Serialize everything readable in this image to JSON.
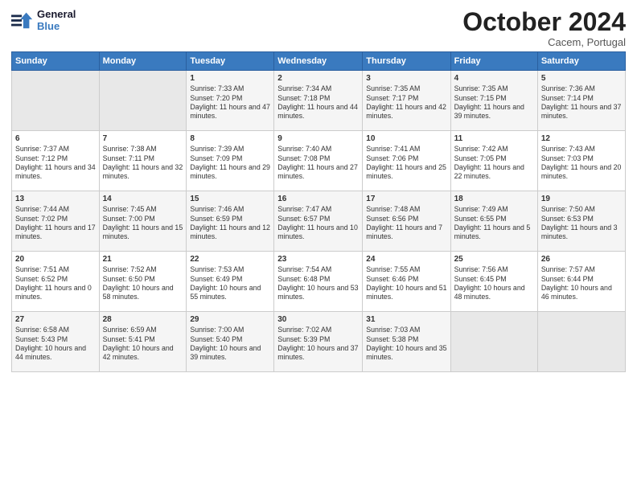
{
  "header": {
    "logo_line1": "General",
    "logo_line2": "Blue",
    "month": "October 2024",
    "location": "Cacem, Portugal"
  },
  "days_of_week": [
    "Sunday",
    "Monday",
    "Tuesday",
    "Wednesday",
    "Thursday",
    "Friday",
    "Saturday"
  ],
  "weeks": [
    [
      {
        "day": "",
        "empty": true
      },
      {
        "day": "",
        "empty": true
      },
      {
        "day": "1",
        "rise": "7:33 AM",
        "set": "7:20 PM",
        "daylight": "11 hours and 47 minutes."
      },
      {
        "day": "2",
        "rise": "7:34 AM",
        "set": "7:18 PM",
        "daylight": "11 hours and 44 minutes."
      },
      {
        "day": "3",
        "rise": "7:35 AM",
        "set": "7:17 PM",
        "daylight": "11 hours and 42 minutes."
      },
      {
        "day": "4",
        "rise": "7:35 AM",
        "set": "7:15 PM",
        "daylight": "11 hours and 39 minutes."
      },
      {
        "day": "5",
        "rise": "7:36 AM",
        "set": "7:14 PM",
        "daylight": "11 hours and 37 minutes."
      }
    ],
    [
      {
        "day": "6",
        "rise": "7:37 AM",
        "set": "7:12 PM",
        "daylight": "11 hours and 34 minutes."
      },
      {
        "day": "7",
        "rise": "7:38 AM",
        "set": "7:11 PM",
        "daylight": "11 hours and 32 minutes."
      },
      {
        "day": "8",
        "rise": "7:39 AM",
        "set": "7:09 PM",
        "daylight": "11 hours and 29 minutes."
      },
      {
        "day": "9",
        "rise": "7:40 AM",
        "set": "7:08 PM",
        "daylight": "11 hours and 27 minutes."
      },
      {
        "day": "10",
        "rise": "7:41 AM",
        "set": "7:06 PM",
        "daylight": "11 hours and 25 minutes."
      },
      {
        "day": "11",
        "rise": "7:42 AM",
        "set": "7:05 PM",
        "daylight": "11 hours and 22 minutes."
      },
      {
        "day": "12",
        "rise": "7:43 AM",
        "set": "7:03 PM",
        "daylight": "11 hours and 20 minutes."
      }
    ],
    [
      {
        "day": "13",
        "rise": "7:44 AM",
        "set": "7:02 PM",
        "daylight": "11 hours and 17 minutes."
      },
      {
        "day": "14",
        "rise": "7:45 AM",
        "set": "7:00 PM",
        "daylight": "11 hours and 15 minutes."
      },
      {
        "day": "15",
        "rise": "7:46 AM",
        "set": "6:59 PM",
        "daylight": "11 hours and 12 minutes."
      },
      {
        "day": "16",
        "rise": "7:47 AM",
        "set": "6:57 PM",
        "daylight": "11 hours and 10 minutes."
      },
      {
        "day": "17",
        "rise": "7:48 AM",
        "set": "6:56 PM",
        "daylight": "11 hours and 7 minutes."
      },
      {
        "day": "18",
        "rise": "7:49 AM",
        "set": "6:55 PM",
        "daylight": "11 hours and 5 minutes."
      },
      {
        "day": "19",
        "rise": "7:50 AM",
        "set": "6:53 PM",
        "daylight": "11 hours and 3 minutes."
      }
    ],
    [
      {
        "day": "20",
        "rise": "7:51 AM",
        "set": "6:52 PM",
        "daylight": "11 hours and 0 minutes."
      },
      {
        "day": "21",
        "rise": "7:52 AM",
        "set": "6:50 PM",
        "daylight": "10 hours and 58 minutes."
      },
      {
        "day": "22",
        "rise": "7:53 AM",
        "set": "6:49 PM",
        "daylight": "10 hours and 55 minutes."
      },
      {
        "day": "23",
        "rise": "7:54 AM",
        "set": "6:48 PM",
        "daylight": "10 hours and 53 minutes."
      },
      {
        "day": "24",
        "rise": "7:55 AM",
        "set": "6:46 PM",
        "daylight": "10 hours and 51 minutes."
      },
      {
        "day": "25",
        "rise": "7:56 AM",
        "set": "6:45 PM",
        "daylight": "10 hours and 48 minutes."
      },
      {
        "day": "26",
        "rise": "7:57 AM",
        "set": "6:44 PM",
        "daylight": "10 hours and 46 minutes."
      }
    ],
    [
      {
        "day": "27",
        "rise": "6:58 AM",
        "set": "5:43 PM",
        "daylight": "10 hours and 44 minutes."
      },
      {
        "day": "28",
        "rise": "6:59 AM",
        "set": "5:41 PM",
        "daylight": "10 hours and 42 minutes."
      },
      {
        "day": "29",
        "rise": "7:00 AM",
        "set": "5:40 PM",
        "daylight": "10 hours and 39 minutes."
      },
      {
        "day": "30",
        "rise": "7:02 AM",
        "set": "5:39 PM",
        "daylight": "10 hours and 37 minutes."
      },
      {
        "day": "31",
        "rise": "7:03 AM",
        "set": "5:38 PM",
        "daylight": "10 hours and 35 minutes."
      },
      {
        "day": "",
        "empty": true
      },
      {
        "day": "",
        "empty": true
      }
    ]
  ]
}
